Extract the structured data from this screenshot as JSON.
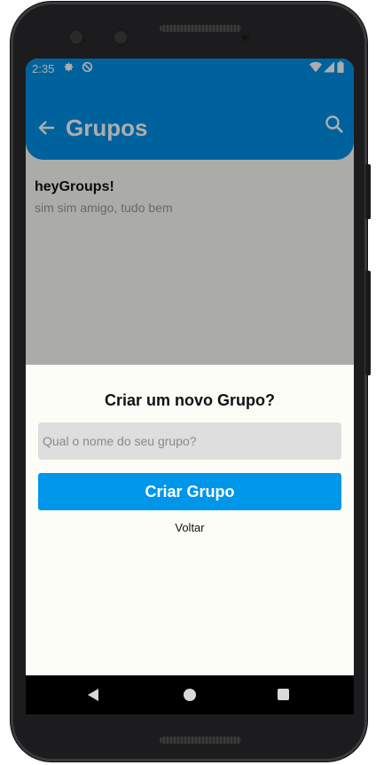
{
  "status_bar": {
    "time": "2:35",
    "left_icons": [
      "gear-icon",
      "do-not-disturb-icon"
    ],
    "right_icons": [
      "wifi-icon",
      "signal-icon",
      "battery-icon"
    ]
  },
  "app_bar": {
    "title": "Grupos",
    "back_icon": "arrow-left-icon",
    "search_icon": "search-icon",
    "color": "#0091e6"
  },
  "groups": [
    {
      "name": "heyGroups!",
      "last_message": "sim sim amigo, tudo bem"
    }
  ],
  "dialog": {
    "title": "Criar um novo Grupo?",
    "input_placeholder": "Qual o nome do seu grupo?",
    "input_value": "",
    "create_button": "Criar Grupo",
    "back_link": "Voltar",
    "button_color": "#0096ea"
  },
  "nav_bar": {
    "icons": [
      "nav-back-icon",
      "nav-home-icon",
      "nav-recents-icon"
    ]
  }
}
